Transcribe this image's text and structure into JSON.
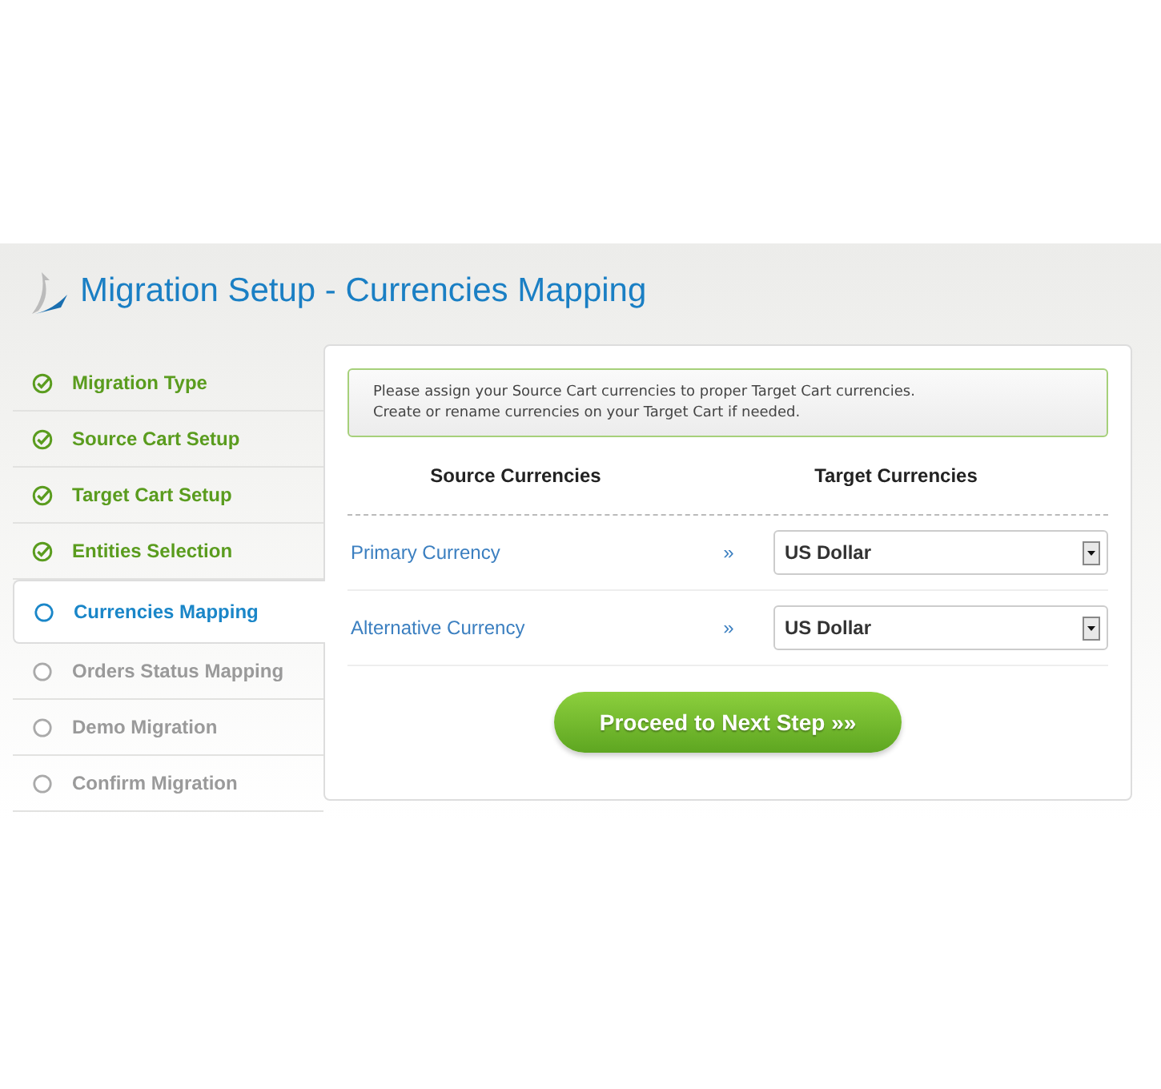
{
  "title": "Migration Setup - Currencies Mapping",
  "steps": [
    {
      "label": "Migration Type",
      "done": true,
      "selected": false
    },
    {
      "label": "Source Cart Setup",
      "done": true,
      "selected": false
    },
    {
      "label": "Target Cart Setup",
      "done": true,
      "selected": false
    },
    {
      "label": "Entities Selection",
      "done": true,
      "selected": false
    },
    {
      "label": "Currencies Mapping",
      "done": false,
      "selected": true
    },
    {
      "label": "Orders Status Mapping",
      "done": false,
      "selected": false
    },
    {
      "label": "Demo Migration",
      "done": false,
      "selected": false
    },
    {
      "label": "Confirm Migration",
      "done": false,
      "selected": false
    }
  ],
  "notice": [
    "Please assign your Source Cart currencies to proper Target Cart currencies.",
    "Create or rename currencies on your Target Cart if needed."
  ],
  "columns": [
    "Source Currencies",
    "Target Currencies"
  ],
  "rows": [
    {
      "source": "Primary Currency",
      "arrow": "»",
      "target": "US Dollar"
    },
    {
      "source": "Alternative Currency",
      "arrow": "»",
      "target": "US Dollar"
    }
  ],
  "button": "Proceed to Next Step »»"
}
